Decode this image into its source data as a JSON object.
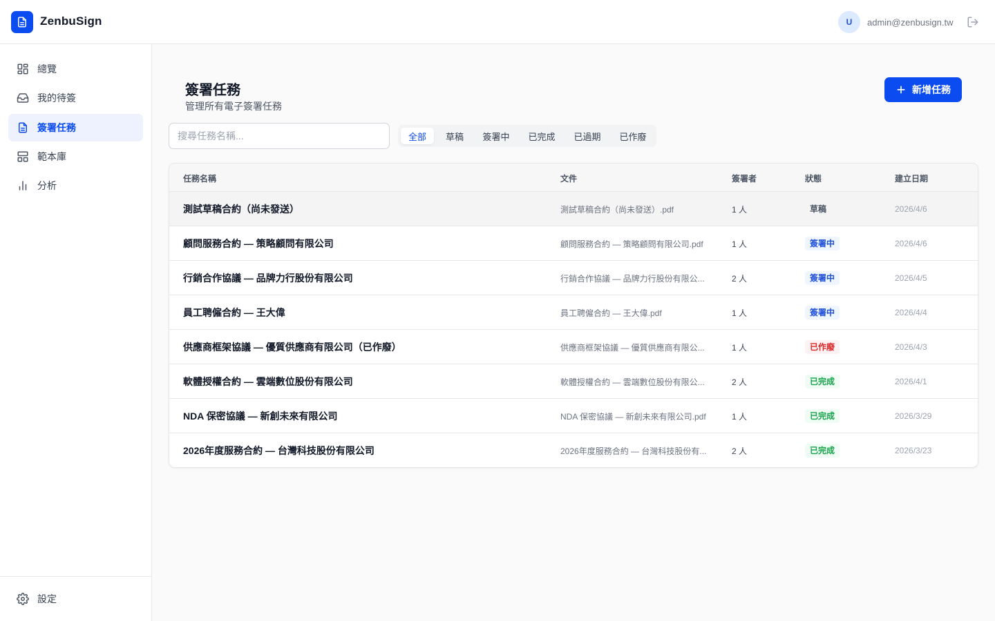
{
  "app": {
    "name": "ZenbuSign"
  },
  "user": {
    "avatar_letter": "U",
    "email": "admin@zenbusign.tw"
  },
  "sidebar": {
    "items": [
      {
        "label": "總覽",
        "icon": "grid-icon"
      },
      {
        "label": "我的待簽",
        "icon": "inbox-icon"
      },
      {
        "label": "簽署任務",
        "icon": "document-icon",
        "active": true
      },
      {
        "label": "範本庫",
        "icon": "template-icon"
      },
      {
        "label": "分析",
        "icon": "bar-chart-icon"
      }
    ],
    "settings": {
      "label": "設定",
      "icon": "gear-icon"
    }
  },
  "page": {
    "title": "簽署任務",
    "subtitle": "管理所有電子簽署任務",
    "new_button": "新增任務"
  },
  "search": {
    "placeholder": "搜尋任務名稱...",
    "value": ""
  },
  "tabs": [
    "全部",
    "草稿",
    "簽署中",
    "已完成",
    "已過期",
    "已作廢"
  ],
  "active_tab": "全部",
  "table": {
    "headers": [
      "任務名稱",
      "文件",
      "簽署者",
      "狀態",
      "建立日期"
    ],
    "rows": [
      {
        "name": "測試草稿合約（尚未發送）",
        "document": "測試草稿合約（尚未發送）.pdf",
        "signers": "1 人",
        "status": "草稿",
        "date": "2026/4/6"
      },
      {
        "name": "顧問服務合約 — 策略顧問有限公司",
        "document": "顧問服務合約 — 策略顧問有限公司.pdf",
        "signers": "1 人",
        "status": "簽署中",
        "date": "2026/4/6"
      },
      {
        "name": "行銷合作協議 — 品牌力行股份有限公司",
        "document": "行銷合作協議 — 品牌力行股份有限公...",
        "signers": "2 人",
        "status": "簽署中",
        "date": "2026/4/5"
      },
      {
        "name": "員工聘僱合約 — 王大偉",
        "document": "員工聘僱合約 — 王大偉.pdf",
        "signers": "1 人",
        "status": "簽署中",
        "date": "2026/4/4"
      },
      {
        "name": "供應商框架協議 — 優質供應商有限公司（已作廢）",
        "document": "供應商框架協議 — 優質供應商有限公...",
        "signers": "1 人",
        "status": "已作廢",
        "date": "2026/4/3"
      },
      {
        "name": "軟體授權合約 — 雲端數位股份有限公司",
        "document": "軟體授權合約 — 雲端數位股份有限公...",
        "signers": "2 人",
        "status": "已完成",
        "date": "2026/4/1"
      },
      {
        "name": "NDA 保密協議 — 新創未來有限公司",
        "document": "NDA 保密協議 — 新創未來有限公司.pdf",
        "signers": "1 人",
        "status": "已完成",
        "date": "2026/3/29"
      },
      {
        "name": "2026年度服務合約 — 台灣科技股份有限公司",
        "document": "2026年度服務合約 — 台灣科技股份有...",
        "signers": "2 人",
        "status": "已完成",
        "date": "2026/3/23"
      }
    ]
  },
  "colors": {
    "primary": "#0b4cf0",
    "status_signing": "#1d4ed8",
    "status_void": "#dc2626",
    "status_done": "#16a34a"
  }
}
